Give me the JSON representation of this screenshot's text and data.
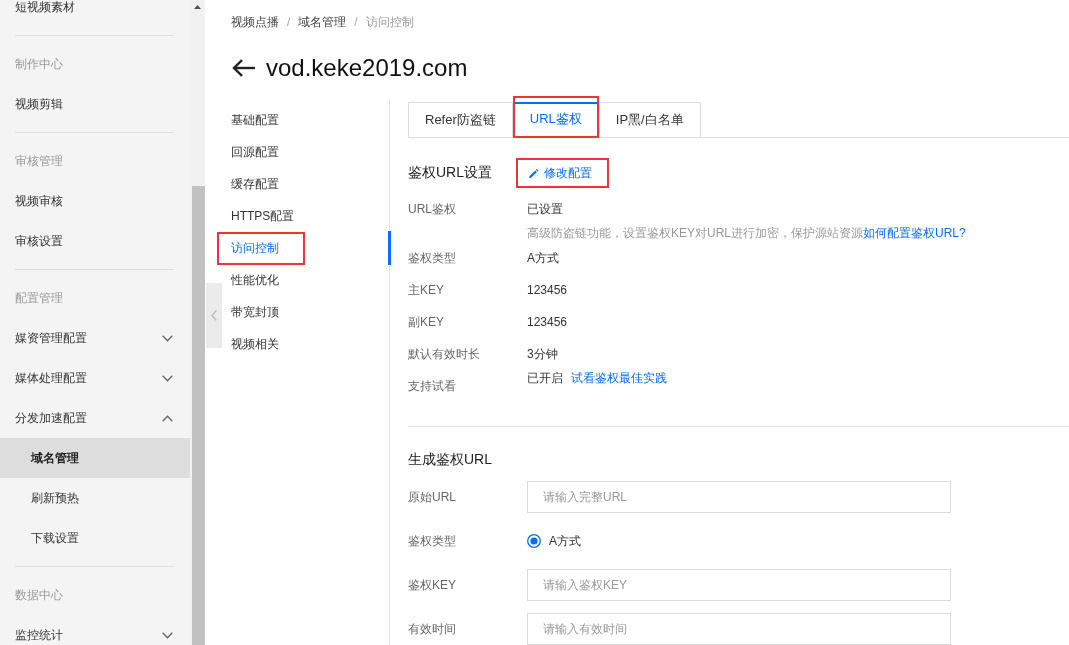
{
  "sidebar": {
    "sections": [
      {
        "items": [
          {
            "label": "短视频素材",
            "selected": false
          }
        ]
      },
      {
        "title": "制作中心",
        "items": [
          {
            "label": "视频剪辑",
            "selected": false
          }
        ]
      },
      {
        "title": "审核管理",
        "items": [
          {
            "label": "视频审核",
            "selected": false
          },
          {
            "label": "审核设置",
            "selected": false
          }
        ]
      },
      {
        "title": "配置管理",
        "items": [
          {
            "label": "媒资管理配置",
            "selected": false,
            "expanded": false
          },
          {
            "label": "媒体处理配置",
            "selected": false,
            "expanded": false
          },
          {
            "label": "分发加速配置",
            "selected": false,
            "expanded": true,
            "children": [
              {
                "label": "域名管理",
                "selected": true
              },
              {
                "label": "刷新预热",
                "selected": false
              },
              {
                "label": "下载设置",
                "selected": false
              }
            ]
          }
        ]
      },
      {
        "title": "数据中心",
        "items": [
          {
            "label": "监控统计",
            "selected": false,
            "expanded": false
          }
        ]
      }
    ]
  },
  "breadcrumb": {
    "separator": "/",
    "items": [
      "视频点播",
      "域名管理",
      "访问控制"
    ]
  },
  "title": "vod.keke2019.com",
  "submenu": [
    {
      "label": "基础配置",
      "selected": false,
      "highlighted": false
    },
    {
      "label": "回源配置",
      "selected": false,
      "highlighted": false
    },
    {
      "label": "缓存配置",
      "selected": false,
      "highlighted": false
    },
    {
      "label": "HTTPS配置",
      "selected": false,
      "highlighted": false
    },
    {
      "label": "访问控制",
      "selected": true,
      "highlighted": true
    },
    {
      "label": "性能优化",
      "selected": false,
      "highlighted": false
    },
    {
      "label": "带宽封顶",
      "selected": false,
      "highlighted": false
    },
    {
      "label": "视频相关",
      "selected": false,
      "highlighted": false
    }
  ],
  "tabs": [
    {
      "label": "Refer防盗链",
      "selected": false,
      "highlighted": false
    },
    {
      "label": "URL鉴权",
      "selected": true,
      "highlighted": true
    },
    {
      "label": "IP黑/白名单",
      "selected": false,
      "highlighted": false
    }
  ],
  "auth_settings": {
    "title": "鉴权URL设置",
    "edit_link": {
      "label": "修改配置",
      "highlighted": true
    },
    "rows": [
      {
        "label": "URL鉴权",
        "value": "已设置",
        "note": {
          "text": "高级防盗链功能，设置鉴权KEY对URL进行加密，保护源站资源",
          "link": "如何配置鉴权URL?"
        }
      },
      {
        "label": "鉴权类型",
        "value": "A方式"
      },
      {
        "label": "主KEY",
        "value": "123456"
      },
      {
        "label": "副KEY",
        "value": "123456"
      },
      {
        "label": "默认有效时长",
        "value": "3分钟"
      },
      {
        "label": "支持试看",
        "value": "已开启",
        "link": "试看鉴权最佳实践"
      }
    ]
  },
  "generate": {
    "title": "生成鉴权URL",
    "fields": [
      {
        "kind": "input",
        "label": "原始URL",
        "placeholder": "请输入完整URL"
      },
      {
        "kind": "radio",
        "label": "鉴权类型",
        "options": [
          {
            "label": "A方式",
            "selected": true
          }
        ]
      },
      {
        "kind": "input",
        "label": "鉴权KEY",
        "placeholder": "请输入鉴权KEY"
      },
      {
        "kind": "input",
        "label": "有效时间",
        "placeholder": "请输入有效时间"
      }
    ]
  }
}
